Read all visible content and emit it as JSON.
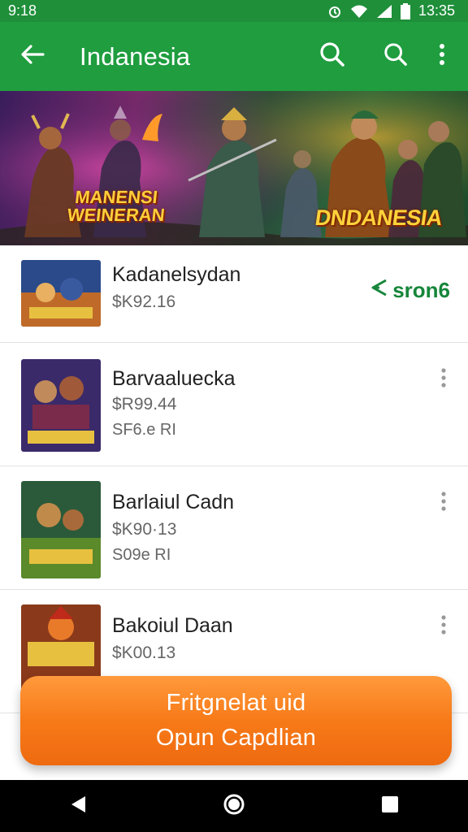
{
  "status_bar": {
    "time": "9:18",
    "clock": "13:35"
  },
  "app_bar": {
    "title": "Indanesia"
  },
  "banner": {
    "logo_left_line1": "MANENSI",
    "logo_left_line2": "WEINERAN",
    "logo_right": "DNDANESIA"
  },
  "items": [
    {
      "title": "Kadanelsydan",
      "price": "$K92.16",
      "sub": "",
      "action_label": "sron6"
    },
    {
      "title": "Barvaaluecka",
      "price": "$R99.44",
      "sub": "SF6.e RI"
    },
    {
      "title": "Barlaiul Cadn",
      "price": "$K90·13",
      "sub": "S09e RI"
    },
    {
      "title": "Bakoiul Daan",
      "price": "$K00.13",
      "sub": ""
    }
  ],
  "cta": {
    "line1": "Fritgnelat uid",
    "line2": "Opun Capdlian"
  },
  "colors": {
    "app_bar": "#1f9d3f",
    "status_bar": "#1f8f3a",
    "cta": "#f77a18",
    "action": "#16863a"
  }
}
